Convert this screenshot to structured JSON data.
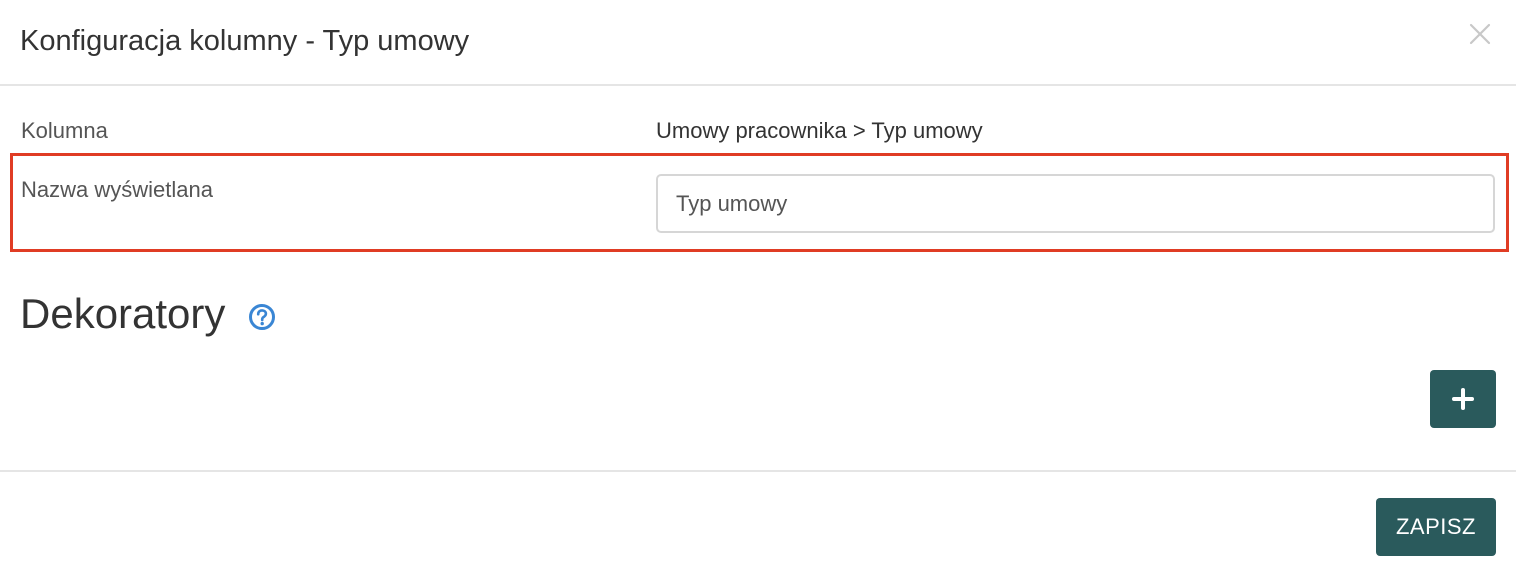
{
  "modal": {
    "title": "Konfiguracja kolumny - Typ umowy"
  },
  "column_row": {
    "label": "Kolumna",
    "value": "Umowy pracownika > Typ umowy"
  },
  "display_name_row": {
    "label": "Nazwa wyświetlana",
    "input_value": "Typ umowy"
  },
  "decorators": {
    "heading": "Dekoratory",
    "help_icon": "question-circle-icon",
    "add_icon": "plus-icon"
  },
  "footer": {
    "save_label": "ZAPISZ"
  },
  "colors": {
    "primary": "#2a5a5c",
    "highlight": "#e03c24",
    "help_icon": "#3a86d4"
  }
}
